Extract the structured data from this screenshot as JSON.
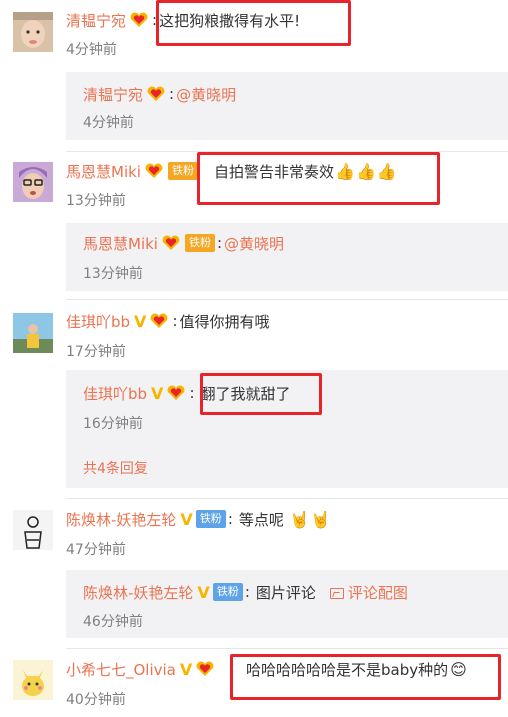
{
  "colors": {
    "username": "#eb7350",
    "meta": "#808080",
    "highlight": "#e8232a",
    "reply_bg": "#f2f2f5"
  },
  "comments": [
    {
      "username": "清韫宁宛",
      "badges": [
        "heart-badge"
      ],
      "text": "这把狗粮撒得有水平!",
      "time": "4分钟前",
      "reply": {
        "username": "清韫宁宛",
        "badges": [
          "heart-badge"
        ],
        "mention": "@黄晓明",
        "time": "4分钟前"
      }
    },
    {
      "username": "馬恩慧Miki",
      "badges": [
        "heart-badge",
        "铁粉"
      ],
      "text": "自拍警告非常奏效",
      "emoji": "thumbs-up-icon x3",
      "time": "13分钟前",
      "reply": {
        "username": "馬恩慧Miki",
        "badges": [
          "heart-badge",
          "铁粉"
        ],
        "mention": "@黄晓明",
        "time": "13分钟前"
      }
    },
    {
      "username": "佳琪吖bb",
      "badges": [
        "V",
        "heart-badge"
      ],
      "text": "值得你拥有哦",
      "time": "17分钟前",
      "reply": {
        "username": "佳琪吖bb",
        "badges": [
          "V",
          "heart-badge"
        ],
        "text": "翻了我就甜了",
        "time": "16分钟前",
        "more": "共4条回复"
      }
    },
    {
      "username": "陈焕林-妖艳左轮",
      "badges": [
        "V",
        "铁粉"
      ],
      "text": "等点呢",
      "emoji": "rock-hand-icon x2",
      "time": "47分钟前",
      "reply": {
        "username": "陈焕林-妖艳左轮",
        "badges": [
          "V",
          "铁粉"
        ],
        "text": "图片评论",
        "pic_link": "评论配图",
        "time": "46分钟前"
      }
    },
    {
      "username": "小希七七_Olivia",
      "badges": [
        "V",
        "heart-badge"
      ],
      "text": "哈哈哈哈哈哈是不是baby种的",
      "emoji": "smile-icon",
      "time": "40分钟前"
    }
  ]
}
